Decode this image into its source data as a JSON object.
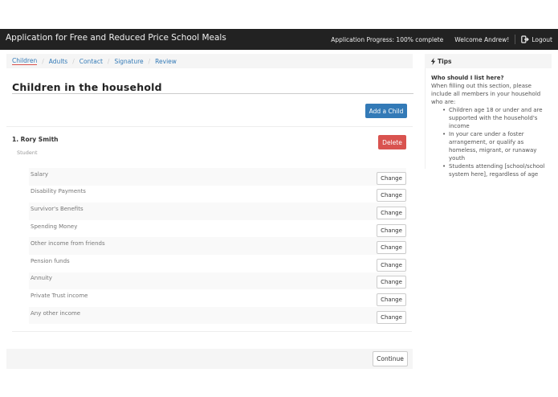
{
  "header": {
    "title": "Application for Free and Reduced Price School Meals",
    "progress": "Application Progress: 100% complete",
    "welcome": "Welcome Andrew!",
    "logout": "Logout"
  },
  "breadcrumb": [
    "Children",
    "Adults",
    "Contact",
    "Signature",
    "Review"
  ],
  "main": {
    "title": "Children in the household",
    "add_child_label": "Add a Child",
    "child": {
      "name": "1. Rory Smith",
      "role": "Student",
      "delete_label": "Delete",
      "incomes": [
        {
          "label": "Salary",
          "action": "Change"
        },
        {
          "label": "Disability Payments",
          "action": "Change"
        },
        {
          "label": "Survivor's Benefits",
          "action": "Change"
        },
        {
          "label": "Spending Money",
          "action": "Change"
        },
        {
          "label": "Other income from friends",
          "action": "Change"
        },
        {
          "label": "Pension funds",
          "action": "Change"
        },
        {
          "label": "Annuity",
          "action": "Change"
        },
        {
          "label": "Private Trust income",
          "action": "Change"
        },
        {
          "label": "Any other income",
          "action": "Change"
        }
      ]
    },
    "continue_label": "Continue"
  },
  "tips": {
    "title": "Tips",
    "question": "Who should I list here?",
    "intro": "When filling out this section, please include all members in your household who are:",
    "items": [
      "Children age 18 or under and are supported with the household's income",
      "In your care under a foster arrangement, or qualify as homeless, migrant, or runaway youth",
      "Students attending [school/school system here], regardless of age"
    ]
  },
  "colors": {
    "navbar": "#222222",
    "primary": "#337ab7",
    "danger": "#d9534f",
    "active_underline": "#d9534f"
  }
}
